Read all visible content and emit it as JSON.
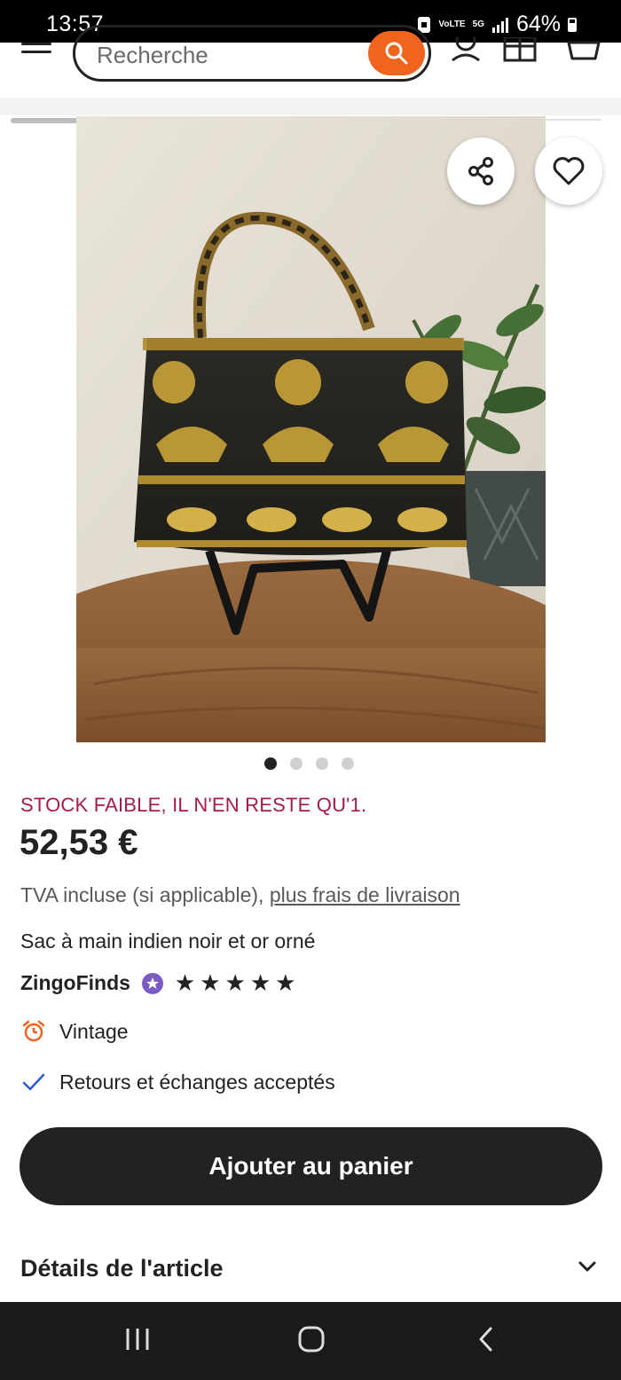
{
  "status_bar": {
    "time": "13:57",
    "network": "5G",
    "volte": "VoLTE",
    "battery": "64%"
  },
  "header": {
    "search_placeholder": "Recherche"
  },
  "product": {
    "image_count": 4,
    "active_image": 1,
    "stock_notice": "STOCK FAIBLE, IL N'EN RESTE QU'1.",
    "price": "52,53 €",
    "tax_text": "TVA incluse (si applicable),",
    "shipping_link": "plus frais de livraison",
    "title": "Sac à main indien noir et or orné",
    "shop_name": "ZingoFinds",
    "rating_stars": 5,
    "features": [
      {
        "icon": "alarm-clock-icon",
        "label": "Vintage"
      },
      {
        "icon": "checkmark-icon",
        "label": "Retours et échanges acceptés"
      }
    ],
    "add_to_cart_label": "Ajouter au panier",
    "details_label": "Détails de l'article"
  },
  "colors": {
    "accent": "#f1641e",
    "stock_warning": "#a61a47",
    "star_seller": "#7b5cc4",
    "check": "#2a5bd7",
    "button_dark": "#222222"
  }
}
